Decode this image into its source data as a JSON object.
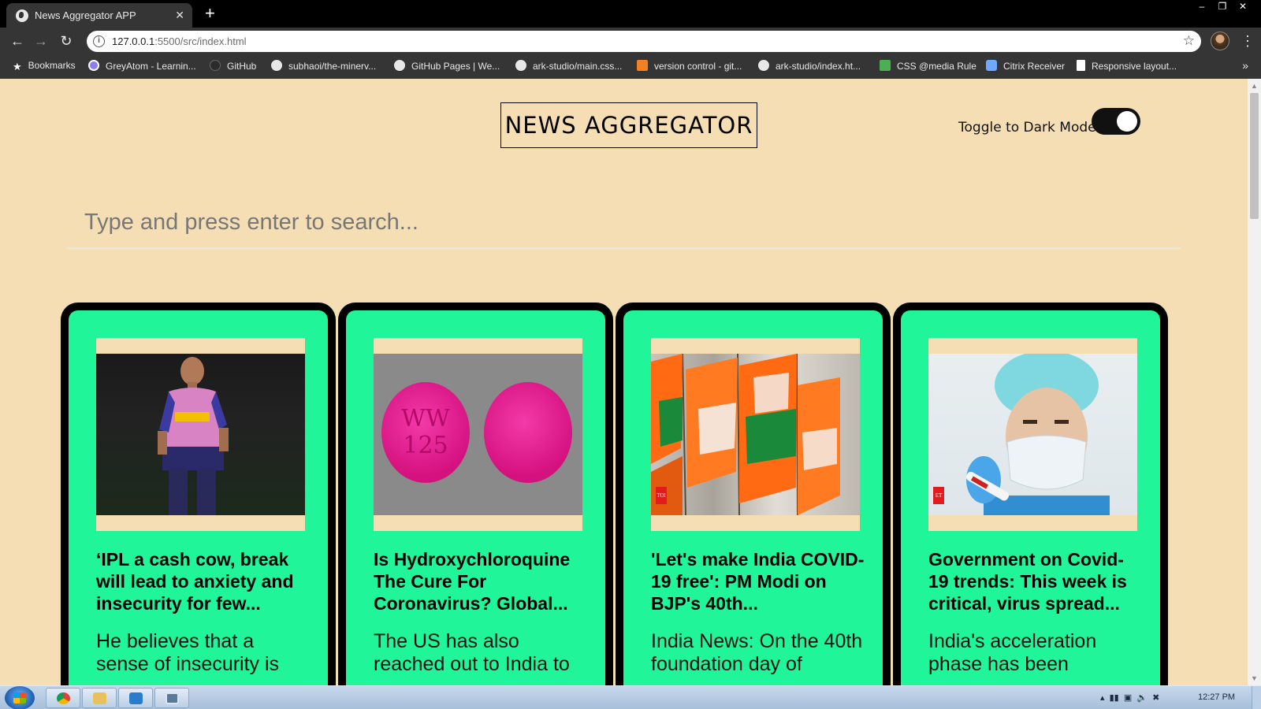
{
  "browser": {
    "tab_title": "News Aggregator APP",
    "tab_close": "✕",
    "new_tab": "+",
    "url_host": "127.0.0.1",
    "url_path": ":5500/src/index.html",
    "window_controls": [
      "–",
      "❐",
      "✕"
    ]
  },
  "bookmarks": [
    {
      "label": "Bookmarks",
      "icon": "star-icon",
      "color": "#ffffff"
    },
    {
      "label": "GreyAtom - Learnin...",
      "icon": "greyatom-icon",
      "color": "#8c7cf0"
    },
    {
      "label": "GitHub",
      "icon": "github-icon",
      "color": "#e8e8e8"
    },
    {
      "label": "subhaoi/the-minerv...",
      "icon": "github-icon",
      "color": "#e8e8e8"
    },
    {
      "label": "GitHub Pages | We...",
      "icon": "github-icon",
      "color": "#e8e8e8"
    },
    {
      "label": "ark-studio/main.css...",
      "icon": "github-icon",
      "color": "#e8e8e8"
    },
    {
      "label": "version control - git...",
      "icon": "stackoverflow-icon",
      "color": "#f48024"
    },
    {
      "label": "ark-studio/index.ht...",
      "icon": "github-icon",
      "color": "#e8e8e8"
    },
    {
      "label": "CSS @media Rule",
      "icon": "w3schools-icon",
      "color": "#4caf50"
    },
    {
      "label": "Citrix Receiver",
      "icon": "citrix-icon",
      "color": "#6fa8ff"
    },
    {
      "label": "Responsive layout...",
      "icon": "doc-icon",
      "color": "#ffffff"
    }
  ],
  "header": {
    "brand": "NEWS AGGREGATOR",
    "toggle_label": "Toggle to Dark Mode",
    "toggle_on": true
  },
  "search": {
    "placeholder": "Type and press enter to search...",
    "value": ""
  },
  "articles": [
    {
      "title": "‘IPL a cash cow, break will lead to anxiety and insecurity for few...",
      "description": "He believes that a sense of insecurity is",
      "image": "cricket-coach-photo"
    },
    {
      "title": "Is Hydroxychloroquine The Cure For Coronavirus? Global...",
      "description": "The US has also reached out to India to",
      "image": "pink-pills-photo",
      "pill_text": "WW\n125"
    },
    {
      "title": "'Let's make India COVID-19 free': PM Modi on BJP's 40th...",
      "description": "India News: On the 40th foundation day of",
      "image": "bjp-flags-photo",
      "badge": "TOI"
    },
    {
      "title": "Government on Covid-19 trends: This week is critical, virus spread...",
      "description": "India's acceleration phase has been",
      "image": "lab-worker-photo",
      "badge": "ET"
    }
  ],
  "taskbar": {
    "clock": "12:27 PM"
  },
  "colors": {
    "page_bg": "#f5deb3",
    "card_border": "#000000",
    "card_bg": "#21f59a"
  }
}
